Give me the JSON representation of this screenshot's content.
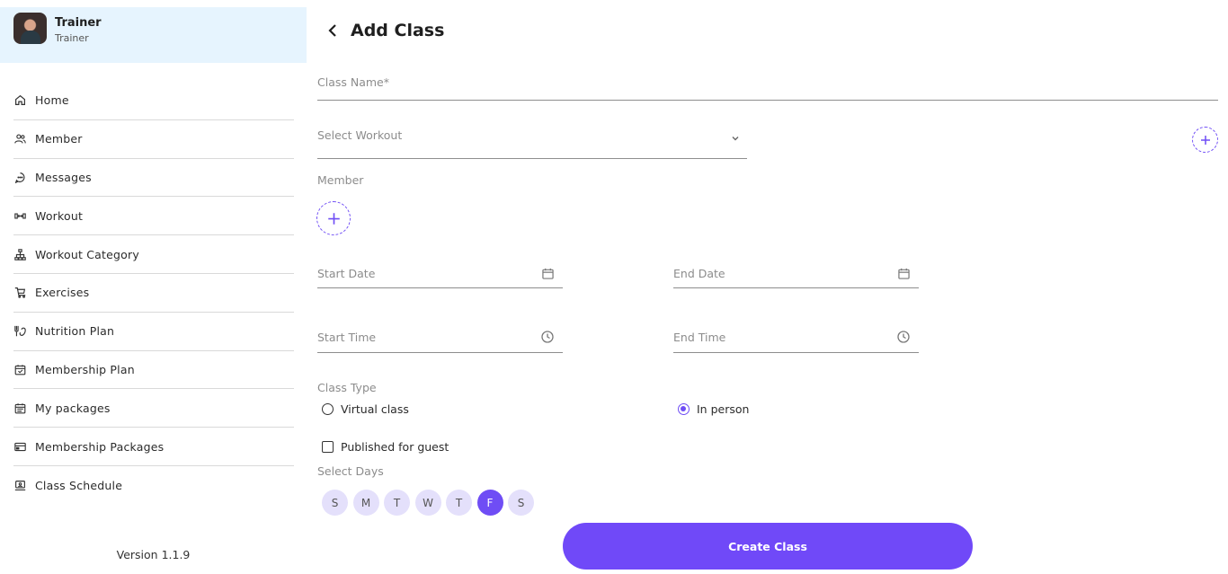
{
  "profile": {
    "name": "Trainer",
    "role": "Trainer"
  },
  "sidebar": {
    "items": [
      {
        "label": "Home",
        "icon": "home-icon"
      },
      {
        "label": "Member",
        "icon": "users-icon"
      },
      {
        "label": "Messages",
        "icon": "chat-icon"
      },
      {
        "label": "Workout",
        "icon": "dumbbell-icon"
      },
      {
        "label": "Workout Category",
        "icon": "hierarchy-icon"
      },
      {
        "label": "Exercises",
        "icon": "treadmill-icon"
      },
      {
        "label": "Nutrition Plan",
        "icon": "nutrition-icon"
      },
      {
        "label": "Membership Plan",
        "icon": "calendar-check-icon"
      },
      {
        "label": "My packages",
        "icon": "calendar-list-icon"
      },
      {
        "label": "Membership Packages",
        "icon": "card-icon"
      },
      {
        "label": "Class Schedule",
        "icon": "monitor-icon"
      }
    ],
    "version": "Version 1.1.9"
  },
  "page": {
    "title": "Add Class"
  },
  "form": {
    "class_name_placeholder": "Class Name*",
    "select_workout_placeholder": "Select Workout",
    "member_label": "Member",
    "start_date_placeholder": "Start Date",
    "end_date_placeholder": "End Date",
    "start_time_placeholder": "Start Time",
    "end_time_placeholder": "End Time",
    "class_type_label": "Class Type",
    "class_type_options": [
      {
        "label": "Virtual class",
        "selected": false
      },
      {
        "label": "In person",
        "selected": true
      }
    ],
    "published_label": "Published for guest",
    "published_checked": false,
    "select_days_label": "Select Days",
    "days": [
      {
        "label": "S",
        "selected": false
      },
      {
        "label": "M",
        "selected": false
      },
      {
        "label": "T",
        "selected": false
      },
      {
        "label": "W",
        "selected": false
      },
      {
        "label": "T",
        "selected": false
      },
      {
        "label": "F",
        "selected": true
      },
      {
        "label": "S",
        "selected": false
      }
    ],
    "submit_label": "Create Class"
  },
  "colors": {
    "accent": "#7049f8",
    "profile_bg": "#e6f4fe",
    "day_bg": "#e4e0fb"
  }
}
